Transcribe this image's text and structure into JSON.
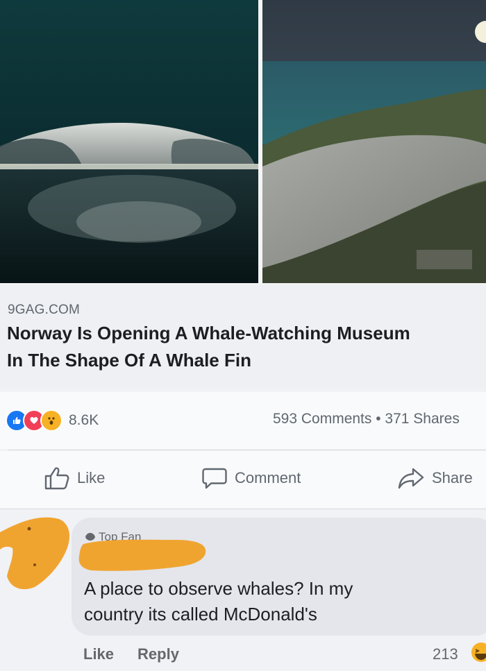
{
  "post": {
    "images": [
      {
        "icon": "whale-fin-museum-night-photo"
      },
      {
        "icon": "whale-fin-museum-aerial-photo"
      }
    ],
    "link": {
      "domain": "9GAG.COM",
      "headline": "Norway Is Opening A Whale-Watching Museum\nIn The Shape Of A Whale Fin"
    },
    "stats": {
      "reaction_icons": [
        "like-icon",
        "love-icon",
        "wow-icon"
      ],
      "reactions_count": "8.6K",
      "comments_shares": "593 Comments • 371 Shares"
    },
    "actions": {
      "like": "Like",
      "comment": "Comment",
      "share": "Share"
    }
  },
  "comment": {
    "badge": "Top Fan",
    "text": "A place to observe whales? In my\ncountry its called McDonald's",
    "like": "Like",
    "reply": "Reply",
    "reaction_count": "213"
  },
  "colors": {
    "accent_blue": "#1877f2",
    "love_red": "#f33e58",
    "wow_yellow": "#f7b125",
    "redaction_orange": "#f0a430"
  }
}
